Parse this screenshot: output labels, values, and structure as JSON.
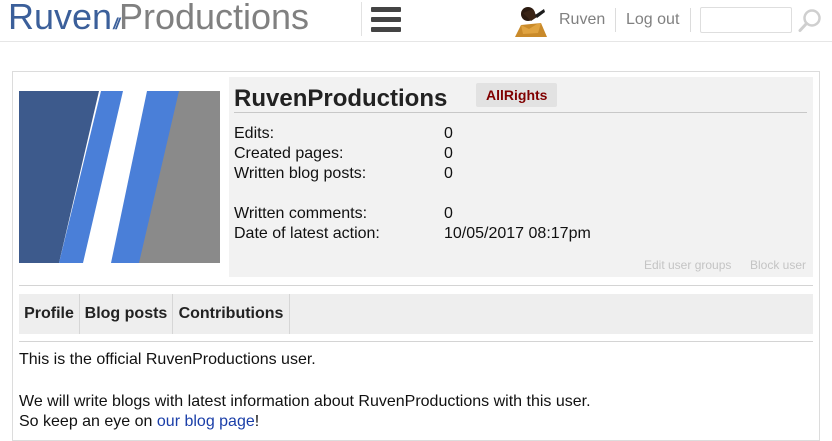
{
  "header": {
    "logo": {
      "part1": "Ruven",
      "slashes": "//",
      "part2": "Productions"
    },
    "user_name": "Ruven",
    "logout_label": "Log out",
    "search_placeholder": ""
  },
  "profile": {
    "username": "RuvenProductions",
    "rights_badge": "AllRights",
    "stats": [
      {
        "label": "Edits:",
        "value": "0"
      },
      {
        "label": "Created pages:",
        "value": "0"
      },
      {
        "label": "Written blog posts:",
        "value": "0"
      },
      {
        "label": "Written comments:",
        "value": "0"
      },
      {
        "label": "Date of latest action:",
        "value": "10/05/2017 08:17pm"
      }
    ],
    "actions": {
      "edit_groups": "Edit user groups",
      "block_user": "Block user"
    }
  },
  "tabs": [
    "Profile",
    "Blog posts",
    "Contributions"
  ],
  "description": {
    "line1": "This is the official RuvenProductions user.",
    "line2": "We will write blogs with latest information about RuvenProductions with this user.",
    "line3_prefix": "So keep an eye on ",
    "line3_link": "our blog page",
    "line3_suffix": "!"
  },
  "colors": {
    "brand_blue": "#3b5f9a",
    "accent_blue": "#4a7fd8",
    "brand_gray": "#808080",
    "rights_badge_text": "#800000",
    "link": "#1a3ea8"
  },
  "icons": {
    "menu": "hamburger-icon",
    "search": "search-icon",
    "avatar": "avatar"
  }
}
